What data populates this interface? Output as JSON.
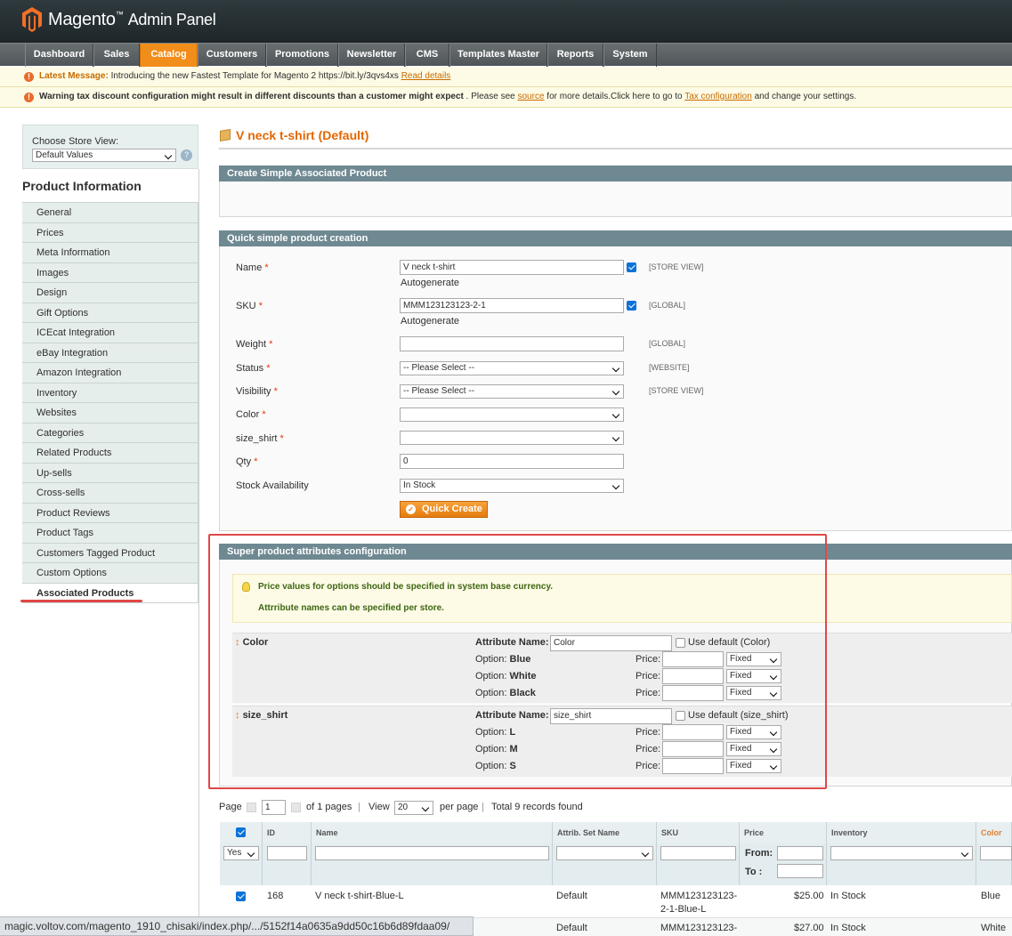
{
  "header": {
    "brand": "Magento",
    "brand_suffix": "Admin Panel"
  },
  "nav": {
    "items": [
      {
        "label": "Dashboard"
      },
      {
        "label": "Sales"
      },
      {
        "label": "Catalog"
      },
      {
        "label": "Customers"
      },
      {
        "label": "Promotions"
      },
      {
        "label": "Newsletter"
      },
      {
        "label": "CMS"
      },
      {
        "label": "Templates Master"
      },
      {
        "label": "Reports"
      },
      {
        "label": "System"
      }
    ],
    "active": "Catalog"
  },
  "messages": {
    "latest_label": "Latest Message:",
    "latest_text": "Introducing the new Fastest Template for Magento 2 https://bit.ly/3qvs4xs",
    "latest_link": "Read details",
    "warning_bold": "Warning tax discount configuration might result in different discounts than a customer might expect",
    "warning_text1": ". Please see",
    "warning_link1": "source",
    "warning_text2": "for more details.Click here to go to",
    "warning_link2": "Tax configuration",
    "warning_text3": "and change your settings."
  },
  "sidebar": {
    "store_view_label": "Choose Store View:",
    "store_view_value": "Default Values",
    "title": "Product Information",
    "items": [
      {
        "label": "General"
      },
      {
        "label": "Prices"
      },
      {
        "label": "Meta Information"
      },
      {
        "label": "Images"
      },
      {
        "label": "Design"
      },
      {
        "label": "Gift Options"
      },
      {
        "label": "ICEcat Integration"
      },
      {
        "label": "eBay Integration"
      },
      {
        "label": "Amazon Integration"
      },
      {
        "label": "Inventory"
      },
      {
        "label": "Websites"
      },
      {
        "label": "Categories"
      },
      {
        "label": "Related Products"
      },
      {
        "label": "Up-sells"
      },
      {
        "label": "Cross-sells"
      },
      {
        "label": "Product Reviews"
      },
      {
        "label": "Product Tags"
      },
      {
        "label": "Customers Tagged Product"
      },
      {
        "label": "Custom Options"
      },
      {
        "label": "Associated Products"
      }
    ]
  },
  "page": {
    "title": "V neck t-shirt (Default)"
  },
  "create_section": {
    "title": "Create Simple Associated Product"
  },
  "quick_section": {
    "title": "Quick simple product creation",
    "name_label": "Name",
    "name_value": "V  neck t-shirt",
    "autogen": "Autogenerate",
    "name_scope": "[STORE VIEW]",
    "sku_label": "SKU",
    "sku_value": "MMM123123123-2-1",
    "sku_scope": "[GLOBAL]",
    "weight_label": "Weight",
    "weight_scope": "[GLOBAL]",
    "status_label": "Status",
    "status_value": "-- Please Select --",
    "status_scope": "[WEBSITE]",
    "visibility_label": "Visibility",
    "visibility_value": "-- Please Select --",
    "visibility_scope": "[STORE VIEW]",
    "color_label": "Color",
    "size_label": "size_shirt",
    "qty_label": "Qty",
    "qty_value": "0",
    "stock_label": "Stock Availability",
    "stock_value": "In Stock",
    "button": "Quick Create"
  },
  "super_section": {
    "title": "Super product attributes configuration",
    "note1": "Price values for options should be specified in system base currency.",
    "note2": "Attrribute names can be specified per store.",
    "attr_name_label": "Attribute Name:",
    "option_label": "Option:",
    "price_label": "Price:",
    "price_type": "Fixed",
    "color": {
      "title": "Color",
      "name_value": "Color",
      "use_default": "Use default (Color)",
      "options": [
        "Blue",
        "White",
        "Black"
      ]
    },
    "size": {
      "title": "size_shirt",
      "name_value": "size_shirt",
      "use_default": "Use default (size_shirt)",
      "options": [
        "L",
        "M",
        "S"
      ]
    }
  },
  "grid": {
    "page_label": "Page",
    "page_value": "1",
    "of_pages": "of 1 pages",
    "view_label": "View",
    "view_value": "20",
    "per_page": "per page",
    "total": "Total 9 records found",
    "columns": [
      "ID",
      "Name",
      "Attrib. Set Name",
      "SKU",
      "Price",
      "Inventory",
      "Color"
    ],
    "filter_yes": "Yes",
    "from_label": "From:",
    "to_label": "To :",
    "rows": [
      {
        "id": "168",
        "name": "V neck t-shirt-Blue-L",
        "set": "Default",
        "sku1": "MMM123123123-",
        "sku2": "2-1-Blue-L",
        "price": "$25.00",
        "inventory": "In Stock",
        "color": "Blue"
      },
      {
        "id": "",
        "name": "",
        "set": "Default",
        "sku1": "MMM123123123-",
        "sku2": "",
        "price": "$27.00",
        "inventory": "In Stock",
        "color": "White"
      }
    ]
  },
  "statusbar": {
    "url": "magic.voltov.com/magento_1910_chisaki/index.php/.../5152f14a0635a9dd50c16b6d89fdaa09/"
  },
  "colors": {
    "accent": "#f18d1b",
    "section": "#6f8992",
    "highlight": "#e04848"
  }
}
